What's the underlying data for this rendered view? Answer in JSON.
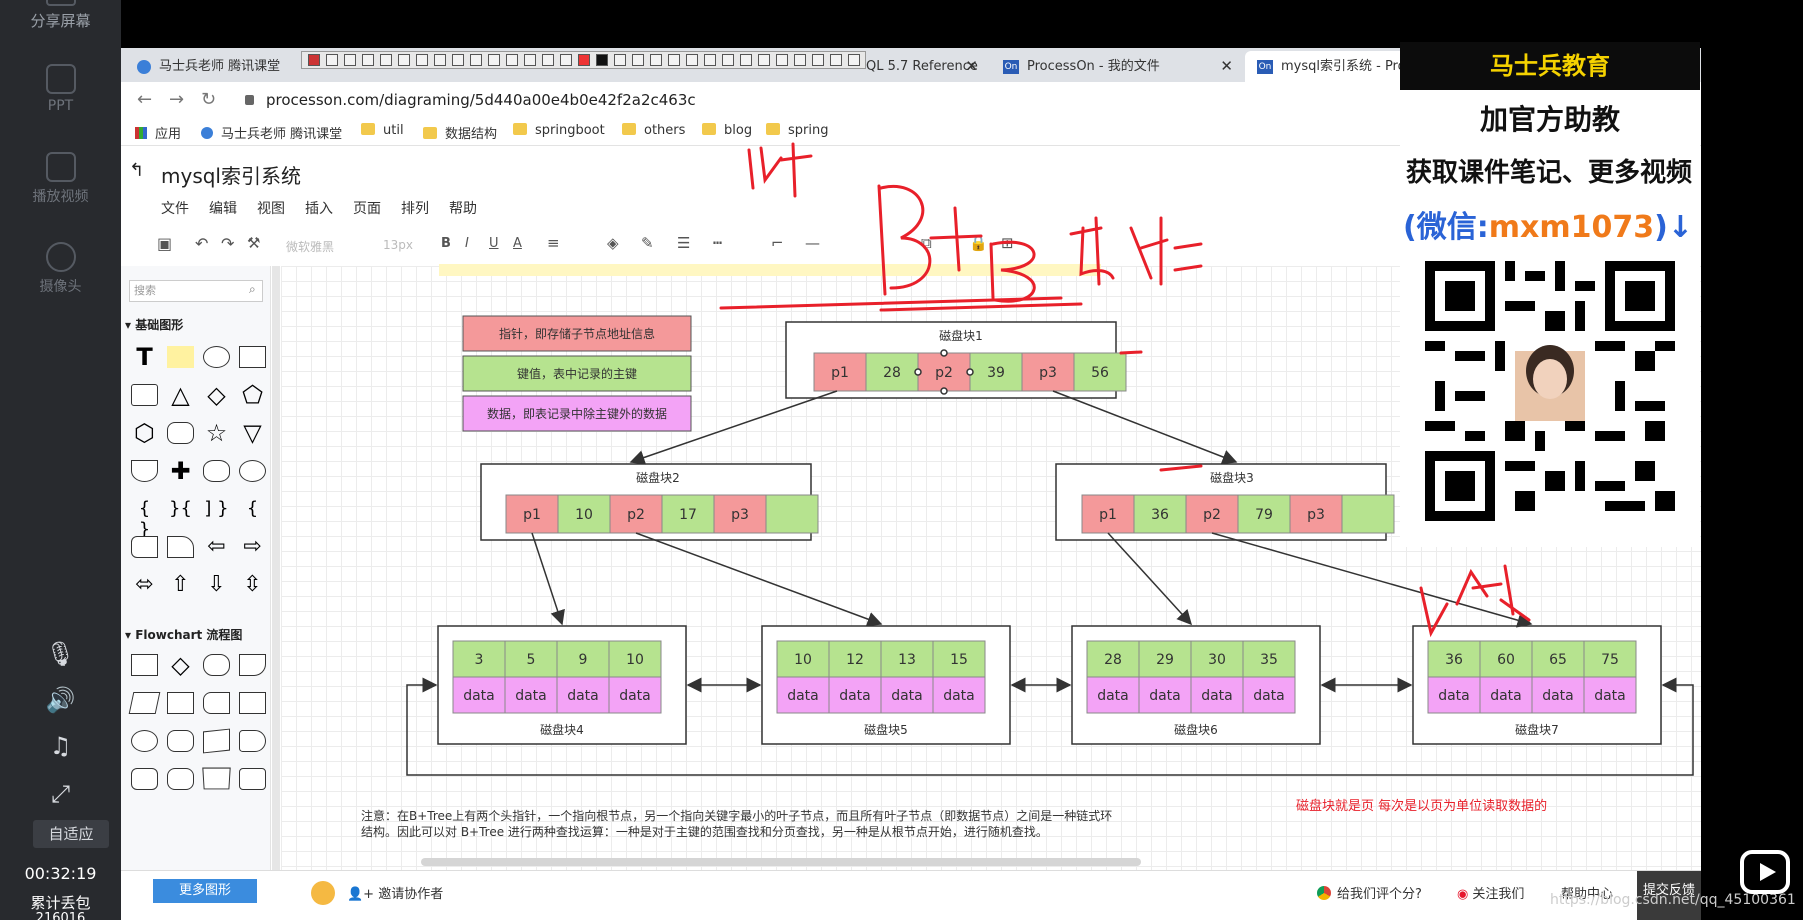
{
  "left_panel": {
    "share": "分享屏幕",
    "ppt": "PPT",
    "play_video": "播放视频",
    "camera": "摄像头",
    "fit": "自适应",
    "time": "00:32:19",
    "packet_loss_label": "累计丢包",
    "packet_loss_value": "216016"
  },
  "tabs": [
    {
      "label": "马士兵老师 腾讯课堂"
    },
    {
      "label": "QL 5.7 Reference"
    },
    {
      "label": "ProcessOn - 我的文件"
    },
    {
      "label": "mysql索引系统 - ProcessOn"
    }
  ],
  "tab_icon_on": "On",
  "url": "processon.com/diagraming/5d440a00e4b0e42f2a2c463c",
  "bookmarks": [
    "应用",
    "马士兵老师 腾讯课堂",
    "util",
    "数据结构",
    "springboot",
    "others",
    "blog",
    "spring"
  ],
  "doc": {
    "title": "mysql索引系统",
    "menus": [
      "文件",
      "编辑",
      "视图",
      "插入",
      "页面",
      "排列",
      "帮助"
    ],
    "font_name": "微软雅黑",
    "font_size": "13px",
    "toolbar_letters": [
      "B",
      "I",
      "U",
      "A"
    ]
  },
  "library": {
    "search_placeholder": "搜索",
    "section_basic": "基础图形",
    "section_flowchart": "Flowchart 流程图"
  },
  "legend": [
    {
      "text": "指针，即存储子节点地址信息",
      "color": "#f4999a"
    },
    {
      "text": "键值，表中记录的主键",
      "color": "#b6e38f"
    },
    {
      "text": "数据，即表记录中除主键外的数据",
      "color": "#f3a3f6"
    }
  ],
  "blocks": {
    "b1": {
      "label": "磁盘块1",
      "cells": [
        "p1",
        "28",
        "p2",
        "39",
        "p3",
        "56"
      ]
    },
    "b2": {
      "label": "磁盘块2",
      "cells": [
        "p1",
        "10",
        "p2",
        "17",
        "p3",
        ""
      ]
    },
    "b3": {
      "label": "磁盘块3",
      "cells": [
        "p1",
        "36",
        "p2",
        "79",
        "p3",
        ""
      ]
    },
    "b4": {
      "label": "磁盘块4",
      "keys": [
        "3",
        "5",
        "9",
        "10"
      ],
      "data": [
        "data",
        "data",
        "data",
        "data"
      ]
    },
    "b5": {
      "label": "磁盘块5",
      "keys": [
        "10",
        "12",
        "13",
        "15"
      ],
      "data": [
        "data",
        "data",
        "data",
        "data"
      ]
    },
    "b6": {
      "label": "磁盘块6",
      "keys": [
        "28",
        "29",
        "30",
        "35"
      ],
      "data": [
        "data",
        "data",
        "data",
        "data"
      ]
    },
    "b7": {
      "label": "磁盘块7",
      "keys": [
        "36",
        "60",
        "65",
        "75"
      ],
      "data": [
        "data",
        "data",
        "data",
        "data"
      ]
    }
  },
  "note_line1": "注意：在B+Tree上有两个头指针，一个指向根节点，另一个指向关键字最小的叶子节点，而且所有叶子节点（即数据节点）之间是一种链式环",
  "note_line2": "结构。因此可以对 B+Tree 进行两种查找运算：一种是对于主键的范围查找和分页查找，另一种是从根节点开始，进行随机查找。",
  "red_note": "磁盘块就是页  每次是以页为单位读取数据的",
  "statusbar": {
    "more_shapes": "更多图形",
    "invite": "邀请协作者",
    "rate": "给我们评个分?",
    "follow": "关注我们",
    "help": "帮助中心",
    "feedback": "提交反馈"
  },
  "ad": {
    "brand": "马士兵教育",
    "line1": "加官方助教",
    "line2": "获取课件笔记、更多视频",
    "line3_prefix": "(微信:",
    "line3_id": "mxm1073",
    "line3_suffix": ")↓"
  },
  "watermark": "https://blog.csdn.net/qq_45100361",
  "colors": {
    "pointer": "#f4999a",
    "key": "#b6e38f",
    "data": "#f3a3f6",
    "ink": "#e8202a",
    "accent": "#3b8cde"
  }
}
